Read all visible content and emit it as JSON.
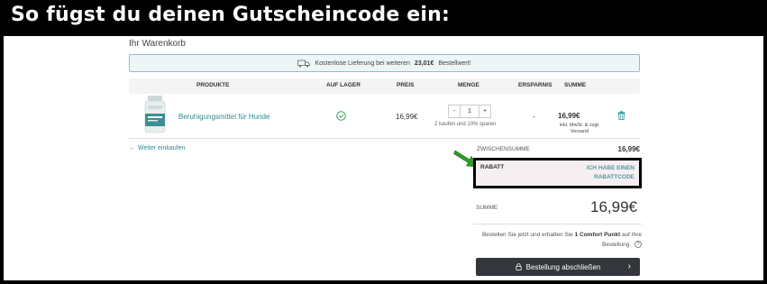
{
  "headline": "So fügst du deinen Gutscheincode ein:",
  "page_title": "Ihr Warenkorb",
  "shipping_banner": {
    "prefix": "Kostenlose Lieferung bei weiteren",
    "amount": "23,01€",
    "suffix": "Bestellwert!"
  },
  "table": {
    "headers": {
      "produkte": "PRODUKTE",
      "lager": "AUF LAGER",
      "preis": "PREIS",
      "menge": "MENGE",
      "ersparnis": "ERSPARNIS",
      "summe": "SUMME"
    },
    "rows": [
      {
        "name": "Beruhigungsmittel für Hunde",
        "price": "16,99€",
        "qty_minus": "-",
        "quantity": "1",
        "qty_plus": "+",
        "qty_hint": "2 kaufen und 10% sparen",
        "savings": "-",
        "sum": "16,99€",
        "sum_note": "inkl. MwSt. & zzgl. Versand"
      }
    ]
  },
  "continue_link": "Weiter einkaufen",
  "summary": {
    "subtotal_label": "ZWISCHENSUMME",
    "subtotal_value": "16,99€",
    "rabatt_label": "RABATT",
    "rabatt_link": "ICH HABE EINEN RABATTCODE",
    "summe_label": "SUMME",
    "summe_value": "16,99€",
    "points_prefix": "Bestellen Sie jetzt und erhalten Sie",
    "points_bold": "1 Comfort Punkt",
    "points_suffix": "auf Ihre Bestellung.",
    "info_glyph": "?",
    "checkout_label": "Bestellung abschließen",
    "chevron": "›"
  },
  "colors": {
    "accent": "#2e8a8f",
    "arrow": "#2f9a2a",
    "button": "#33363b"
  }
}
